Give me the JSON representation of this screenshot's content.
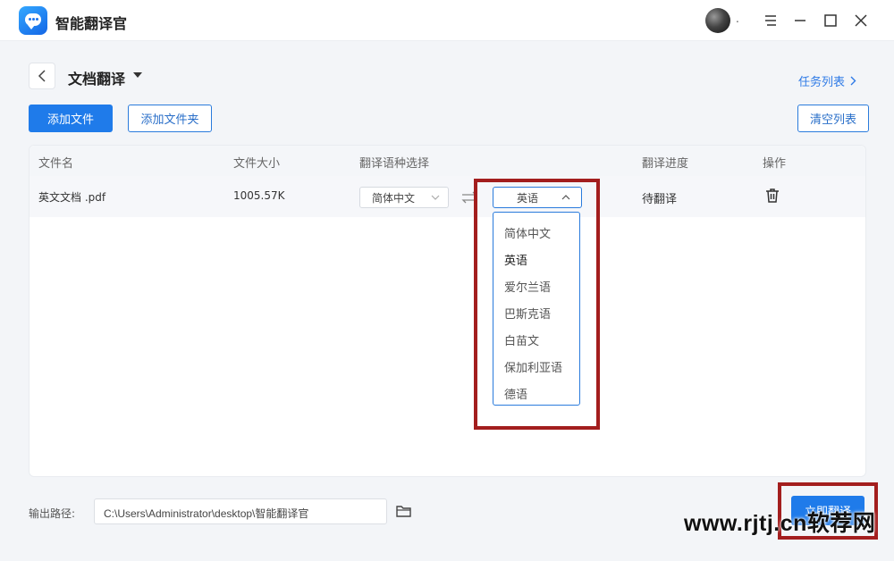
{
  "app": {
    "title": "智能翻译官"
  },
  "window_controls": [
    "menu-icon",
    "minimize-icon",
    "maximize-icon",
    "close-icon"
  ],
  "header": {
    "page_title": "文档翻译",
    "task_list_link": "任务列表"
  },
  "toolbar": {
    "add_file": "添加文件",
    "add_folder": "添加文件夹",
    "clear_list": "清空列表"
  },
  "table": {
    "columns": [
      "文件名",
      "文件大小",
      "翻译语种选择",
      "翻译进度",
      "操作"
    ],
    "rows": [
      {
        "file_name": "英文文档 .pdf",
        "file_size": "1005.57K",
        "source_lang": "简体中文",
        "target_lang": "英语",
        "progress": "待翻译"
      }
    ]
  },
  "dropdown": {
    "open": true,
    "selected": "英语",
    "options": [
      "简体中文",
      "英语",
      "爱尔兰语",
      "巴斯克语",
      "白苗文",
      "保加利亚语",
      "德语"
    ]
  },
  "footer": {
    "output_label": "输出路径:",
    "output_path": "C:\\Users\\Administrator\\desktop\\智能翻译官",
    "translate_button": "立即翻译"
  },
  "watermark": "www.rjtj.cn软荐网",
  "colors": {
    "primary": "#1f7bea",
    "highlight_border": "#a31e1e"
  }
}
